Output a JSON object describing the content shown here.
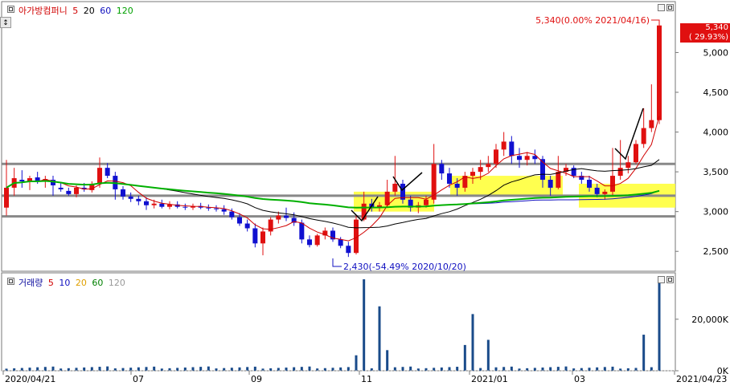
{
  "legend_price": {
    "stock": "아가방컴퍼니",
    "ma5": "5",
    "ma20": "20",
    "ma60": "60",
    "ma120": "120",
    "colors": {
      "stock": "#d00000",
      "ma5": "#d00000",
      "ma20": "#000000",
      "ma60": "#1010c0",
      "ma120": "#00a000"
    }
  },
  "legend_volume": {
    "label": "거래량",
    "v5": "5",
    "v10": "10",
    "v20": "20",
    "v60": "60",
    "v120": "120",
    "colors": {
      "label": "#1010a0",
      "v5": "#d00000",
      "v10": "#1010c0",
      "v20": "#e0a000",
      "v60": "#008000",
      "v120": "#999999"
    }
  },
  "side_icon": "zoom-button-icon",
  "side_label": "↕",
  "annotations": {
    "high": "5,340(0.00% 2021/04/16)",
    "low": "2,430(-54.49% 2020/10/20)"
  },
  "current_price": {
    "value": "5,340",
    "change": "( 29.93%)"
  },
  "chart_data": {
    "type": "candlestick",
    "price_axis": {
      "ticks": [
        "5,000",
        "4,500",
        "4,000",
        "3,500",
        "3,000",
        "2,500"
      ],
      "range": [
        2250,
        5640
      ]
    },
    "volume_axis": {
      "ticks": [
        "20,000K",
        "0K"
      ],
      "range": [
        0,
        38000
      ]
    },
    "x_ticks": [
      "2020/04/21",
      "07",
      "09",
      "11",
      "2021/01",
      "03",
      "2021/04/23"
    ],
    "support_resistance_lines": [
      3600,
      3200,
      2940
    ],
    "highlight_zones": "yellow",
    "ohlc": [
      [
        3050,
        3650,
        2950,
        3300
      ],
      [
        3300,
        3550,
        3200,
        3420
      ],
      [
        3400,
        3520,
        3300,
        3380
      ],
      [
        3380,
        3450,
        3270,
        3420
      ],
      [
        3430,
        3500,
        3350,
        3380
      ],
      [
        3380,
        3450,
        3300,
        3410
      ],
      [
        3400,
        3450,
        3200,
        3330
      ],
      [
        3300,
        3360,
        3250,
        3280
      ],
      [
        3260,
        3300,
        3200,
        3220
      ],
      [
        3220,
        3330,
        3180,
        3300
      ],
      [
        3300,
        3360,
        3250,
        3280
      ],
      [
        3270,
        3380,
        3240,
        3350
      ],
      [
        3350,
        3680,
        3300,
        3550
      ],
      [
        3550,
        3610,
        3420,
        3450
      ],
      [
        3450,
        3500,
        3150,
        3280
      ],
      [
        3280,
        3320,
        3150,
        3190
      ],
      [
        3190,
        3240,
        3120,
        3160
      ],
      [
        3160,
        3200,
        3080,
        3130
      ],
      [
        3130,
        3180,
        3020,
        3080
      ],
      [
        3080,
        3150,
        3040,
        3100
      ],
      [
        3100,
        3150,
        3040,
        3060
      ],
      [
        3060,
        3130,
        3030,
        3090
      ],
      [
        3090,
        3130,
        3040,
        3060
      ],
      [
        3060,
        3100,
        3020,
        3050
      ],
      [
        3050,
        3100,
        3020,
        3070
      ],
      [
        3070,
        3110,
        3030,
        3050
      ],
      [
        3050,
        3090,
        3010,
        3040
      ],
      [
        3040,
        3080,
        3000,
        3030
      ],
      [
        3030,
        3080,
        2960,
        3000
      ],
      [
        3000,
        3040,
        2900,
        2930
      ],
      [
        2930,
        2980,
        2820,
        2850
      ],
      [
        2850,
        2900,
        2750,
        2790
      ],
      [
        2790,
        2850,
        2550,
        2600
      ],
      [
        2600,
        2800,
        2450,
        2750
      ],
      [
        2750,
        2930,
        2700,
        2900
      ],
      [
        2900,
        3000,
        2850,
        2950
      ],
      [
        2950,
        3050,
        2880,
        2920
      ],
      [
        2920,
        2990,
        2820,
        2860
      ],
      [
        2860,
        2900,
        2600,
        2650
      ],
      [
        2650,
        2700,
        2550,
        2580
      ],
      [
        2580,
        2720,
        2560,
        2700
      ],
      [
        2700,
        2800,
        2650,
        2760
      ],
      [
        2760,
        2800,
        2620,
        2650
      ],
      [
        2650,
        2680,
        2540,
        2570
      ],
      [
        2570,
        2620,
        2430,
        2480
      ],
      [
        2480,
        2950,
        2460,
        2900
      ],
      [
        2900,
        3250,
        2880,
        3100
      ],
      [
        3100,
        3160,
        3000,
        3050
      ],
      [
        3050,
        3120,
        3000,
        3080
      ],
      [
        3080,
        3400,
        3050,
        3250
      ],
      [
        3250,
        3700,
        3200,
        3350
      ],
      [
        3350,
        3400,
        3100,
        3150
      ],
      [
        3150,
        3200,
        3000,
        3050
      ],
      [
        3050,
        3120,
        2980,
        3080
      ],
      [
        3080,
        3200,
        3050,
        3150
      ],
      [
        3150,
        3850,
        3100,
        3600
      ],
      [
        3600,
        3650,
        3400,
        3480
      ],
      [
        3480,
        3550,
        3300,
        3350
      ],
      [
        3350,
        3420,
        3200,
        3300
      ],
      [
        3300,
        3500,
        3250,
        3450
      ],
      [
        3450,
        3550,
        3350,
        3500
      ],
      [
        3500,
        3650,
        3400,
        3560
      ],
      [
        3560,
        3700,
        3500,
        3600
      ],
      [
        3600,
        3850,
        3550,
        3780
      ],
      [
        3780,
        4000,
        3700,
        3880
      ],
      [
        3880,
        3950,
        3600,
        3700
      ],
      [
        3700,
        3800,
        3550,
        3650
      ],
      [
        3650,
        3750,
        3580,
        3700
      ],
      [
        3700,
        3780,
        3600,
        3660
      ],
      [
        3660,
        3700,
        3300,
        3400
      ],
      [
        3400,
        3450,
        3200,
        3300
      ],
      [
        3300,
        3700,
        3280,
        3500
      ],
      [
        3500,
        3600,
        3450,
        3550
      ],
      [
        3550,
        3580,
        3420,
        3450
      ],
      [
        3450,
        3500,
        3350,
        3400
      ],
      [
        3400,
        3450,
        3250,
        3300
      ],
      [
        3300,
        3350,
        3180,
        3220
      ],
      [
        3220,
        3280,
        3150,
        3250
      ],
      [
        3250,
        3800,
        3200,
        3450
      ],
      [
        3450,
        3900,
        3400,
        3550
      ],
      [
        3550,
        3700,
        3480,
        3620
      ],
      [
        3620,
        3900,
        3600,
        3850
      ],
      [
        3850,
        4300,
        3800,
        4050
      ],
      [
        4050,
        4600,
        4000,
        4150
      ],
      [
        4150,
        5340,
        4100,
        5340
      ]
    ],
    "volume_note": "volume bars with spikes near 2020/10/20 and 2021/04/16"
  }
}
